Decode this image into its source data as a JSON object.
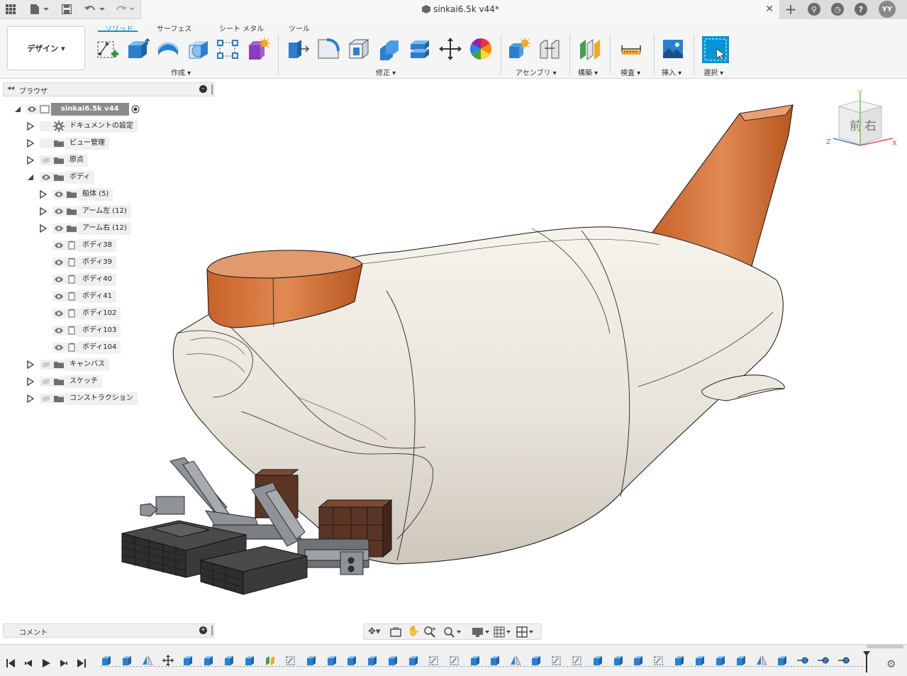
{
  "app": {
    "document_title": "sinkai6.5k v44*",
    "user_initials": "YY"
  },
  "ribbon": {
    "workspace_label": "デザイン ▾",
    "tabs": [
      {
        "label": "ソリッド",
        "active": true
      },
      {
        "label": "サーフェス",
        "active": false
      },
      {
        "label": "シート メタル",
        "active": false
      },
      {
        "label": "ツール",
        "active": false
      }
    ],
    "groups": {
      "create": "作成 ▾",
      "modify": "修正 ▾",
      "assemble": "アセンブリ ▾",
      "construct": "構築 ▾",
      "inspect": "検査 ▾",
      "insert": "挿入 ▾",
      "select": "選択 ▾"
    }
  },
  "browser": {
    "title": "ブラウザ",
    "root": {
      "label": "sinkai6.5k v44"
    },
    "items": [
      {
        "label": "ドキュメントの設定"
      },
      {
        "label": "ビュー管理"
      },
      {
        "label": "原点"
      },
      {
        "label": "ボディ"
      },
      {
        "label": "船体 (5)"
      },
      {
        "label": "アーム左 (12)"
      },
      {
        "label": "アーム右 (12)"
      },
      {
        "label": "ボディ38"
      },
      {
        "label": "ボディ39"
      },
      {
        "label": "ボディ40"
      },
      {
        "label": "ボディ41"
      },
      {
        "label": "ボディ102"
      },
      {
        "label": "ボディ103"
      },
      {
        "label": "ボディ104"
      },
      {
        "label": "キャンバス"
      },
      {
        "label": "スケッチ"
      },
      {
        "label": "コンストラクション"
      }
    ]
  },
  "comment": {
    "title": "コメント"
  },
  "viewcube": {
    "front": "前",
    "right": "右",
    "x": "X",
    "y": "Y",
    "z": "Z"
  },
  "colors": {
    "accent": "#0696d7",
    "hull": "#ebe6dc",
    "orange": "#d4763e",
    "arm_dark": "#2e2e2e",
    "brown": "#5a3324"
  }
}
